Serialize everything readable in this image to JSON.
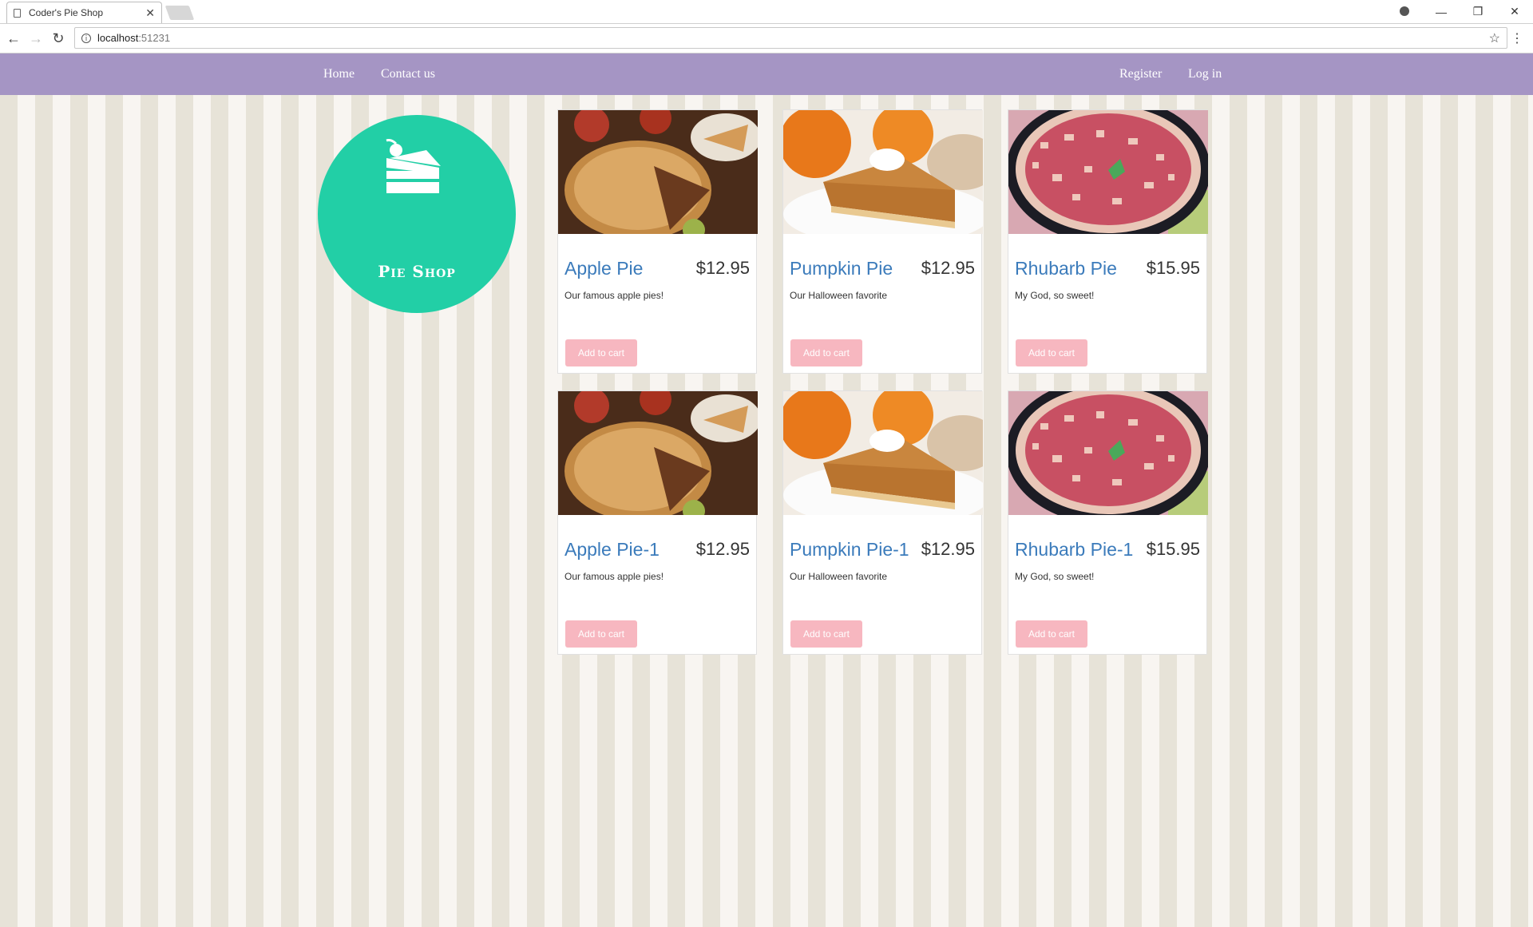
{
  "browser": {
    "tab_title": "Coder's Pie Shop",
    "url_host": "localhost",
    "url_port": ":51231"
  },
  "nav": {
    "home": "Home",
    "contact": "Contact us",
    "register": "Register",
    "login": "Log in"
  },
  "logo": {
    "text": "Pie Shop"
  },
  "colors": {
    "navbar": "#a595c4",
    "logo_circle": "#22cfa6",
    "pie_name": "#3b7bbb",
    "cart_button": "#f7b7c0"
  },
  "products": [
    {
      "name": "Apple Pie",
      "price": "$12.95",
      "description": "Our famous apple pies!",
      "button": "Add to cart",
      "image": "apple-pie-image"
    },
    {
      "name": "Pumpkin Pie",
      "price": "$12.95",
      "description": "Our Halloween favorite",
      "button": "Add to cart",
      "image": "pumpkin-pie-image"
    },
    {
      "name": "Rhubarb Pie",
      "price": "$15.95",
      "description": "My God, so sweet!",
      "button": "Add to cart",
      "image": "rhubarb-pie-image"
    },
    {
      "name": "Apple Pie-1",
      "price": "$12.95",
      "description": "Our famous apple pies!",
      "button": "Add to cart",
      "image": "apple-pie-image"
    },
    {
      "name": "Pumpkin Pie-1",
      "price": "$12.95",
      "description": "Our Halloween favorite",
      "button": "Add to cart",
      "image": "pumpkin-pie-image"
    },
    {
      "name": "Rhubarb Pie-1",
      "price": "$15.95",
      "description": "My God, so sweet!",
      "button": "Add to cart",
      "image": "rhubarb-pie-image"
    }
  ]
}
